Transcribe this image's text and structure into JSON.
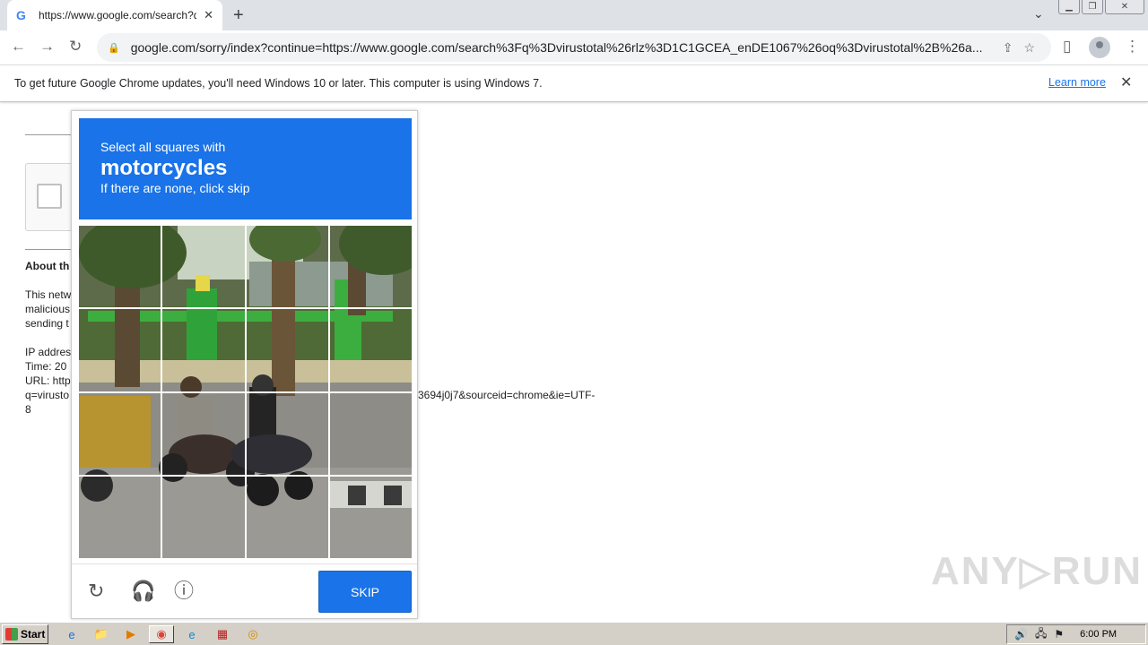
{
  "browser": {
    "tab": {
      "favicon": "G",
      "title": "https://www.google.com/search?q=",
      "close": "✕"
    },
    "new_tab": "+",
    "tab_search": "⌄",
    "window_buttons": {
      "minimize": "▁",
      "restore": "❐",
      "close": "✕"
    },
    "nav": {
      "back": "←",
      "forward": "→",
      "reload": "↻",
      "menu": "⋮",
      "share": "⇪",
      "star": "☆",
      "sidepanel": "▯"
    },
    "url": "google.com/sorry/index?continue=https://www.google.com/search%3Fq%3Dvirustotal%26rlz%3D1C1GCEA_enDE1067%26oq%3Dvirustotal%2B%26a...",
    "lock_icon": "🔒"
  },
  "infobar": {
    "message": "To get future Google Chrome updates, you'll need Windows 10 or later. This computer is using Windows 7.",
    "link": "Learn more",
    "close": "✕"
  },
  "background_page": {
    "about_heading": "About th",
    "para": [
      "This netw",
      "malicious",
      "sending t"
    ],
    "ip_label": "IP addres",
    "time_label": "Time: 20",
    "url_label": "URL: http",
    "url_cont": "q=virusto",
    "url_tail": "3694j0j7&sourceid=chrome&ie=UTF-",
    "url_end": "8"
  },
  "challenge": {
    "line1": "Select all squares with",
    "keyword": "motorcycles",
    "line3": "If there are none, click skip",
    "skip_label": "SKIP",
    "reload_icon": "↻",
    "audio_icon": "🎧",
    "info_icon": "ⓘ"
  },
  "watermark": "ANY▷RUN",
  "taskbar": {
    "start_label": "Start",
    "clock": "6:00 PM",
    "tray_icons": [
      "🔊",
      "🖧",
      "⚑"
    ],
    "items": [
      "e",
      "📁",
      "▶",
      "◉",
      "e",
      "▦",
      "◎"
    ]
  }
}
